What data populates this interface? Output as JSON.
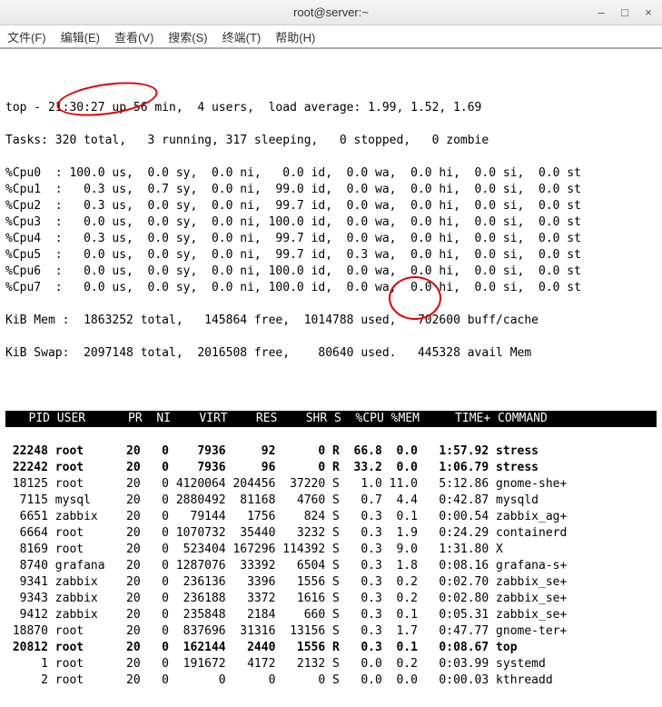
{
  "window": {
    "title": "root@server:~",
    "menus": [
      "文件(F)",
      "编辑(E)",
      "查看(V)",
      "搜索(S)",
      "终端(T)",
      "帮助(H)"
    ]
  },
  "top_summary": {
    "line1": "top - 21:30:27 up 56 min,  4 users,  load average: 1.99, 1.52, 1.69",
    "line2": "Tasks: 320 total,   3 running, 317 sleeping,   0 stopped,   0 zombie"
  },
  "cpus": [
    {
      "label": "%Cpu0",
      "us": "100.0",
      "sy": "0.0",
      "ni": "0.0",
      "id": "0.0",
      "wa": "0.0",
      "hi": "0.0",
      "si": "0.0",
      "st": "0.0"
    },
    {
      "label": "%Cpu1",
      "us": "0.3",
      "sy": "0.7",
      "ni": "0.0",
      "id": "99.0",
      "wa": "0.0",
      "hi": "0.0",
      "si": "0.0",
      "st": "0.0"
    },
    {
      "label": "%Cpu2",
      "us": "0.3",
      "sy": "0.0",
      "ni": "0.0",
      "id": "99.7",
      "wa": "0.0",
      "hi": "0.0",
      "si": "0.0",
      "st": "0.0"
    },
    {
      "label": "%Cpu3",
      "us": "0.0",
      "sy": "0.0",
      "ni": "0.0",
      "id": "100.0",
      "wa": "0.0",
      "hi": "0.0",
      "si": "0.0",
      "st": "0.0"
    },
    {
      "label": "%Cpu4",
      "us": "0.3",
      "sy": "0.0",
      "ni": "0.0",
      "id": "99.7",
      "wa": "0.0",
      "hi": "0.0",
      "si": "0.0",
      "st": "0.0"
    },
    {
      "label": "%Cpu5",
      "us": "0.0",
      "sy": "0.0",
      "ni": "0.0",
      "id": "99.7",
      "wa": "0.3",
      "hi": "0.0",
      "si": "0.0",
      "st": "0.0"
    },
    {
      "label": "%Cpu6",
      "us": "0.0",
      "sy": "0.0",
      "ni": "0.0",
      "id": "100.0",
      "wa": "0.0",
      "hi": "0.0",
      "si": "0.0",
      "st": "0.0"
    },
    {
      "label": "%Cpu7",
      "us": "0.0",
      "sy": "0.0",
      "ni": "0.0",
      "id": "100.0",
      "wa": "0.0",
      "hi": "0.0",
      "si": "0.0",
      "st": "0.0"
    }
  ],
  "mem": {
    "line1": "KiB Mem :  1863252 total,   145864 free,  1014788 used,   702600 buff/cache",
    "line2": "KiB Swap:  2097148 total,  2016508 free,    80640 used.   445328 avail Mem "
  },
  "columns": "   PID USER      PR  NI    VIRT    RES    SHR S  %CPU %MEM     TIME+ COMMAND    ",
  "procs": [
    {
      "pid": "22248",
      "user": "root",
      "pr": "20",
      "ni": "0",
      "virt": "7936",
      "res": "92",
      "shr": "0",
      "s": "R",
      "cpu": "66.8",
      "mem": "0.0",
      "time": "1:57.92",
      "cmd": "stress",
      "bold": true
    },
    {
      "pid": "22242",
      "user": "root",
      "pr": "20",
      "ni": "0",
      "virt": "7936",
      "res": "96",
      "shr": "0",
      "s": "R",
      "cpu": "33.2",
      "mem": "0.0",
      "time": "1:06.79",
      "cmd": "stress",
      "bold": true
    },
    {
      "pid": "18125",
      "user": "root",
      "pr": "20",
      "ni": "0",
      "virt": "4120064",
      "res": "204456",
      "shr": "37220",
      "s": "S",
      "cpu": "1.0",
      "mem": "11.0",
      "time": "5:12.86",
      "cmd": "gnome-she+",
      "bold": false
    },
    {
      "pid": "7115",
      "user": "mysql",
      "pr": "20",
      "ni": "0",
      "virt": "2880492",
      "res": "81168",
      "shr": "4760",
      "s": "S",
      "cpu": "0.7",
      "mem": "4.4",
      "time": "0:42.87",
      "cmd": "mysqld",
      "bold": false
    },
    {
      "pid": "6651",
      "user": "zabbix",
      "pr": "20",
      "ni": "0",
      "virt": "79144",
      "res": "1756",
      "shr": "824",
      "s": "S",
      "cpu": "0.3",
      "mem": "0.1",
      "time": "0:00.54",
      "cmd": "zabbix_ag+",
      "bold": false
    },
    {
      "pid": "6664",
      "user": "root",
      "pr": "20",
      "ni": "0",
      "virt": "1070732",
      "res": "35440",
      "shr": "3232",
      "s": "S",
      "cpu": "0.3",
      "mem": "1.9",
      "time": "0:24.29",
      "cmd": "containerd",
      "bold": false
    },
    {
      "pid": "8169",
      "user": "root",
      "pr": "20",
      "ni": "0",
      "virt": "523404",
      "res": "167296",
      "shr": "114392",
      "s": "S",
      "cpu": "0.3",
      "mem": "9.0",
      "time": "1:31.80",
      "cmd": "X",
      "bold": false
    },
    {
      "pid": "8740",
      "user": "grafana",
      "pr": "20",
      "ni": "0",
      "virt": "1287076",
      "res": "33392",
      "shr": "6504",
      "s": "S",
      "cpu": "0.3",
      "mem": "1.8",
      "time": "0:08.16",
      "cmd": "grafana-s+",
      "bold": false
    },
    {
      "pid": "9341",
      "user": "zabbix",
      "pr": "20",
      "ni": "0",
      "virt": "236136",
      "res": "3396",
      "shr": "1556",
      "s": "S",
      "cpu": "0.3",
      "mem": "0.2",
      "time": "0:02.70",
      "cmd": "zabbix_se+",
      "bold": false
    },
    {
      "pid": "9343",
      "user": "zabbix",
      "pr": "20",
      "ni": "0",
      "virt": "236188",
      "res": "3372",
      "shr": "1616",
      "s": "S",
      "cpu": "0.3",
      "mem": "0.2",
      "time": "0:02.80",
      "cmd": "zabbix_se+",
      "bold": false
    },
    {
      "pid": "9412",
      "user": "zabbix",
      "pr": "20",
      "ni": "0",
      "virt": "235848",
      "res": "2184",
      "shr": "660",
      "s": "S",
      "cpu": "0.3",
      "mem": "0.1",
      "time": "0:05.31",
      "cmd": "zabbix_se+",
      "bold": false
    },
    {
      "pid": "18870",
      "user": "root",
      "pr": "20",
      "ni": "0",
      "virt": "837696",
      "res": "31316",
      "shr": "13156",
      "s": "S",
      "cpu": "0.3",
      "mem": "1.7",
      "time": "0:47.77",
      "cmd": "gnome-ter+",
      "bold": false
    },
    {
      "pid": "20812",
      "user": "root",
      "pr": "20",
      "ni": "0",
      "virt": "162144",
      "res": "2440",
      "shr": "1556",
      "s": "R",
      "cpu": "0.3",
      "mem": "0.1",
      "time": "0:08.67",
      "cmd": "top",
      "bold": true
    },
    {
      "pid": "1",
      "user": "root",
      "pr": "20",
      "ni": "0",
      "virt": "191672",
      "res": "4172",
      "shr": "2132",
      "s": "S",
      "cpu": "0.0",
      "mem": "0.2",
      "time": "0:03.99",
      "cmd": "systemd",
      "bold": false
    },
    {
      "pid": "2",
      "user": "root",
      "pr": "20",
      "ni": "0",
      "virt": "0",
      "res": "0",
      "shr": "0",
      "s": "S",
      "cpu": "0.0",
      "mem": "0.0",
      "time": "0:00.03",
      "cmd": "kthreadd",
      "bold": false
    }
  ]
}
